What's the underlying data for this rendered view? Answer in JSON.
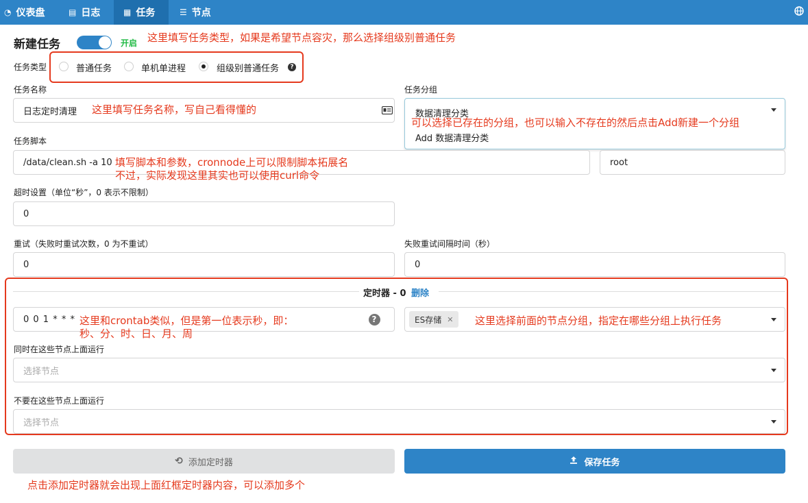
{
  "nav": {
    "items": [
      {
        "icon": "dashboard-icon",
        "glyph": "◔",
        "label": "仪表盘"
      },
      {
        "icon": "document-icon",
        "glyph": "▤",
        "label": "日志"
      },
      {
        "icon": "calendar-icon",
        "glyph": "▦",
        "label": "任务"
      },
      {
        "icon": "server-icon",
        "glyph": "☰",
        "label": "节点"
      }
    ],
    "active": "任务"
  },
  "form": {
    "title": "新建任务",
    "toggle_label": "开启",
    "task_type_label": "任务类型",
    "task_type_options": [
      "普通任务",
      "单机单进程",
      "组级别普通任务"
    ],
    "task_type_selected": "组级别普通任务",
    "task_name_label": "任务名称",
    "task_name_value": "日志定时清理",
    "task_group_label": "任务分组",
    "task_group_value": "数据清理分类",
    "task_group_dropdown_item": "Add 数据清理分类",
    "task_script_label": "任务脚本",
    "task_script_value": "/data/clean.sh -a 10",
    "user_value": "root",
    "timeout_label": "超时设置（单位“秒”，0 表示不限制）",
    "timeout_value": "0",
    "retry_label": "重试（失败时重试次数，0 为不重试）",
    "retry_value": "0",
    "retry_interval_label": "失败重试间隔时间（秒）",
    "retry_interval_value": "0",
    "timer_header": "定时器 - 0",
    "timer_delete": "删除",
    "timer_value": "0 0 1 * * *",
    "node_group_tag": "ES存储",
    "run_nodes_label": "同时在这些节点上面运行",
    "run_nodes_placeholder": "选择节点",
    "exclude_nodes_label": "不要在这些节点上面运行",
    "exclude_nodes_placeholder": "选择节点",
    "add_timer_button": "添加定时器",
    "save_button": "保存任务"
  },
  "annotations": {
    "task_type": "这里填写任务类型，如果是希望节点容灾，那么选择组级别普通任务",
    "task_name": "这里填写任务名称，写自己看得懂的",
    "task_group": "可以选择已存在的分组，也可以输入不存在的然后点击Add新建一个分组",
    "script_line1": "填写脚本和参数，cronnode上可以限制脚本拓展名",
    "script_line2": "不过，实际发现这里其实也可以使用curl命令",
    "timer_line1": "这里和crontab类似，但是第一位表示秒，即：",
    "timer_line2": "秒、分、时、日、月、周",
    "node_group": "这里选择前面的节点分组，指定在哪些分组上执行任务",
    "add_timer": "点击添加定时器就会出现上面红框定时器内容，可以添加多个"
  },
  "colors": {
    "nav": "#2e84c7",
    "nav_active": "#1f6fae",
    "primary": "#2e84c7",
    "toggle_on": "#2e84c7",
    "toggle_label": "#21ba45",
    "annotation": "#e5391d",
    "disabled_button": "#e0e1e2"
  }
}
